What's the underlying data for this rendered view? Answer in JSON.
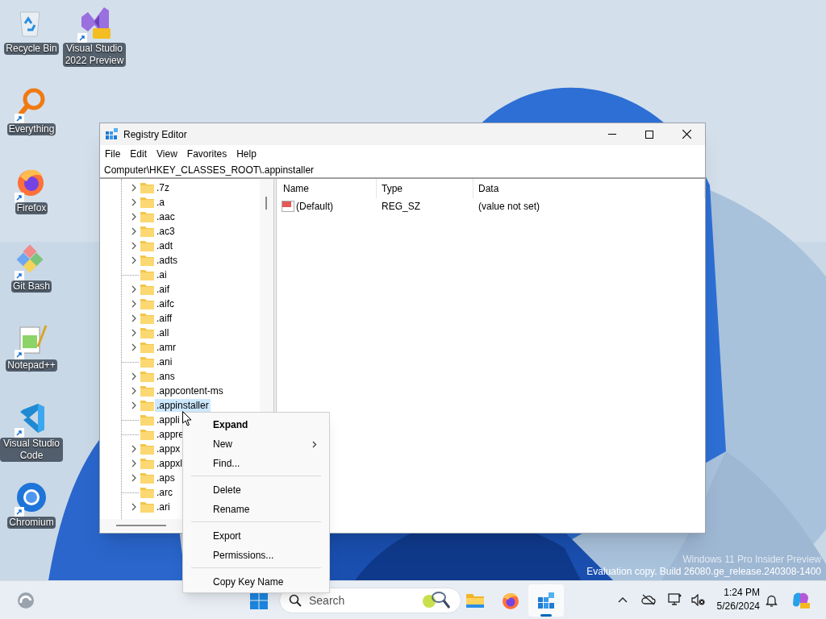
{
  "desktop_icons": [
    {
      "label": "Recycle Bin",
      "kind": "recycle",
      "shortcut": false
    },
    {
      "label": "Visual Studio 2022 Preview",
      "kind": "vs-preview",
      "shortcut": true
    },
    {
      "label": "Everything",
      "kind": "everything",
      "shortcut": true
    },
    {
      "label": "Firefox",
      "kind": "firefox",
      "shortcut": true
    },
    {
      "label": "Git Bash",
      "kind": "git",
      "shortcut": true
    },
    {
      "label": "Notepad++",
      "kind": "notepad",
      "shortcut": true
    },
    {
      "label": "Visual Studio Code",
      "kind": "vscode",
      "shortcut": true
    },
    {
      "label": "Chromium",
      "kind": "chromium",
      "shortcut": true
    }
  ],
  "window": {
    "title": "Registry Editor",
    "menu": [
      "File",
      "Edit",
      "View",
      "Favorites",
      "Help"
    ],
    "address": "Computer\\HKEY_CLASSES_ROOT\\.appinstaller",
    "tree": [
      {
        "label": ".7z",
        "expandable": true,
        "selected": false
      },
      {
        "label": ".a",
        "expandable": true,
        "selected": false
      },
      {
        "label": ".aac",
        "expandable": true,
        "selected": false
      },
      {
        "label": ".ac3",
        "expandable": true,
        "selected": false
      },
      {
        "label": ".adt",
        "expandable": true,
        "selected": false
      },
      {
        "label": ".adts",
        "expandable": true,
        "selected": false
      },
      {
        "label": ".ai",
        "expandable": false,
        "selected": false
      },
      {
        "label": ".aif",
        "expandable": true,
        "selected": false
      },
      {
        "label": ".aifc",
        "expandable": true,
        "selected": false
      },
      {
        "label": ".aiff",
        "expandable": true,
        "selected": false
      },
      {
        "label": ".all",
        "expandable": true,
        "selected": false
      },
      {
        "label": ".amr",
        "expandable": true,
        "selected": false
      },
      {
        "label": ".ani",
        "expandable": false,
        "selected": false
      },
      {
        "label": ".ans",
        "expandable": true,
        "selected": false
      },
      {
        "label": ".appcontent-ms",
        "expandable": true,
        "selected": false
      },
      {
        "label": ".appinstaller",
        "expandable": true,
        "selected": true
      },
      {
        "label": ".appli",
        "expandable": false,
        "selected": false
      },
      {
        "label": ".appre",
        "expandable": false,
        "selected": false
      },
      {
        "label": ".appx",
        "expandable": true,
        "selected": false
      },
      {
        "label": ".appxl",
        "expandable": true,
        "selected": false
      },
      {
        "label": ".aps",
        "expandable": true,
        "selected": false
      },
      {
        "label": ".arc",
        "expandable": false,
        "selected": false
      },
      {
        "label": ".ari",
        "expandable": true,
        "selected": false
      }
    ],
    "columns": [
      "Name",
      "Type",
      "Data"
    ],
    "values": [
      {
        "name": "(Default)",
        "type": "REG_SZ",
        "data": "(value not set)"
      }
    ]
  },
  "context_menu": {
    "groups": [
      [
        {
          "label": "Expand",
          "default": true,
          "submenu": false
        },
        {
          "label": "New",
          "default": false,
          "submenu": true
        },
        {
          "label": "Find...",
          "default": false,
          "submenu": false
        }
      ],
      [
        {
          "label": "Delete",
          "default": false,
          "submenu": false
        },
        {
          "label": "Rename",
          "default": false,
          "submenu": false
        }
      ],
      [
        {
          "label": "Export",
          "default": false,
          "submenu": false
        },
        {
          "label": "Permissions...",
          "default": false,
          "submenu": false
        }
      ],
      [
        {
          "label": "Copy Key Name",
          "default": false,
          "submenu": false
        }
      ]
    ]
  },
  "build_info": {
    "edition": "Windows 11 Pro Insider Preview",
    "build": "Evaluation copy. Build 26080.ge_release.240308-1400"
  },
  "taskbar": {
    "search_placeholder": "Search",
    "apps": [
      {
        "kind": "explorer",
        "active": false
      },
      {
        "kind": "firefox",
        "active": false
      },
      {
        "kind": "regedit",
        "active": true
      }
    ],
    "time": "1:24 PM",
    "date": "5/26/2024"
  }
}
